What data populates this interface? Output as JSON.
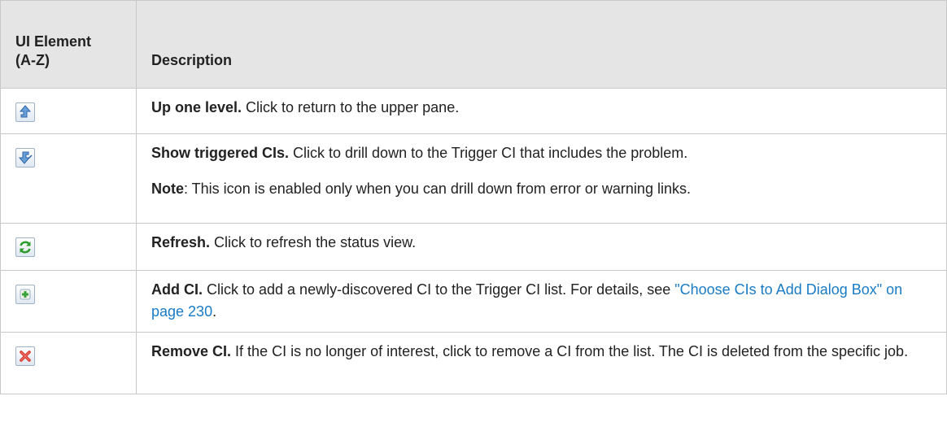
{
  "table": {
    "header": {
      "col1_line1": "UI Element",
      "col1_line2": "(A-Z)",
      "col2": "Description"
    },
    "rows": [
      {
        "icon": "up-one-level-icon",
        "title": "Up one level.",
        "text": " Click to return to the upper pane."
      },
      {
        "icon": "show-triggered-cis-icon",
        "title": "Show triggered CIs.",
        "text": " Click to drill down to the Trigger CI that includes the problem.",
        "note_label": "Note",
        "note_text": ": This icon is enabled only when you can drill down from error or warning links."
      },
      {
        "icon": "refresh-icon",
        "title": "Refresh.",
        "text": " Click to refresh the status view."
      },
      {
        "icon": "add-ci-icon",
        "title": "Add CI.",
        "text": " Click to add a newly-discovered CI to the Trigger CI list. For details, see ",
        "link": "\"Choose CIs to Add Dialog Box\" on page 230",
        "after_link": "."
      },
      {
        "icon": "remove-ci-icon",
        "title": "Remove CI.",
        "text": " If the CI is no longer of interest, click to remove a CI from the list. The CI is deleted from the specific job."
      }
    ]
  },
  "colors": {
    "header_bg": "#e5e5e5",
    "border": "#c8c8c8",
    "link": "#1a7bc4",
    "text": "#222222"
  }
}
